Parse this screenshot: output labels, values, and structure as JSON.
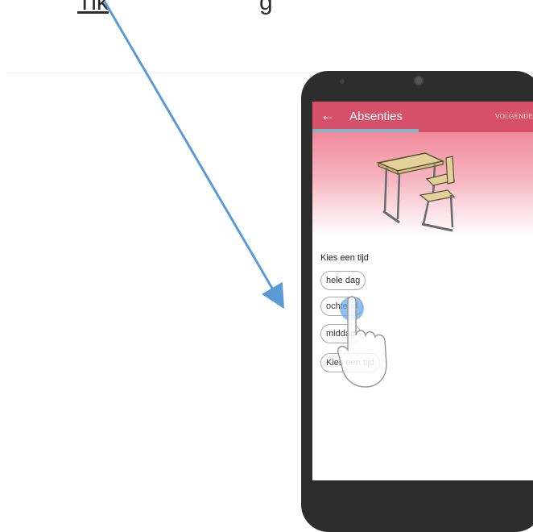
{
  "top_text": {
    "underlined": "Tik",
    "right": "g"
  },
  "app": {
    "title": "Absenties",
    "back_icon": "arrow-left-icon",
    "next_label": "VOLGENDE",
    "progress": 0.48,
    "accent_color": "#d55068",
    "progress_color": "#7fb6c8"
  },
  "form": {
    "prompt": "Kies een tijd",
    "options": [
      "hele dag",
      "ochtend",
      "middag",
      "Kies een tijd"
    ]
  }
}
